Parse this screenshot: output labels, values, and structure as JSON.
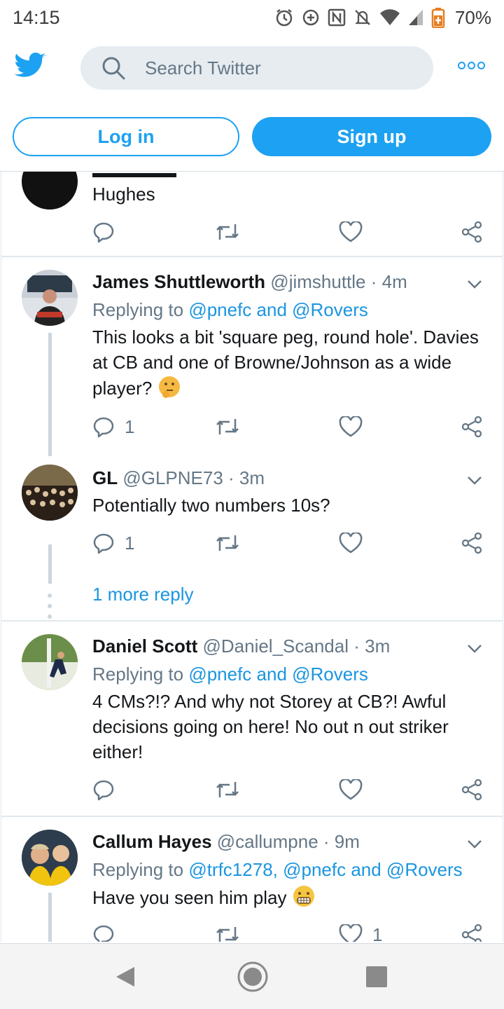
{
  "status_bar": {
    "time": "14:15",
    "battery": "70%"
  },
  "header": {
    "search_placeholder": "Search Twitter"
  },
  "auth": {
    "login_label": "Log in",
    "signup_label": "Sign up"
  },
  "tweets": [
    {
      "text": "Hughes"
    },
    {
      "name": "James Shuttleworth",
      "handle": "@jimshuttle",
      "time": "· 4m",
      "reply_prefix": "Replying to ",
      "reply_links": "@pnefc and @Rovers",
      "text": "This looks a bit 'square peg, round hole'. Davies at CB and one of Browne/Johnson as a wide player?",
      "reply_count": "1"
    },
    {
      "name": "GL",
      "handle": "@GLPNE73",
      "time": "· 3m",
      "text": "Potentially two numbers 10s?",
      "reply_count": "1",
      "more_replies": "1 more reply"
    },
    {
      "name": "Daniel Scott",
      "handle": "@Daniel_Scandal",
      "time": "· 3m",
      "reply_prefix": "Replying to ",
      "reply_links": "@pnefc and @Rovers",
      "text": "4 CMs?!? And why not Storey at CB?! Awful decisions going on here! No out n out striker either!"
    },
    {
      "name": "Callum Hayes",
      "handle": "@callumpne",
      "time": "· 9m",
      "reply_prefix": "Replying to ",
      "reply_links": "@trfc1278, @pnefc and @Rovers",
      "text": "Have you seen him play",
      "like_count": "1"
    }
  ],
  "colors": {
    "accent": "#1da1f2",
    "link": "#1b95e0",
    "muted": "#657786",
    "divider": "#e1e8ed"
  }
}
